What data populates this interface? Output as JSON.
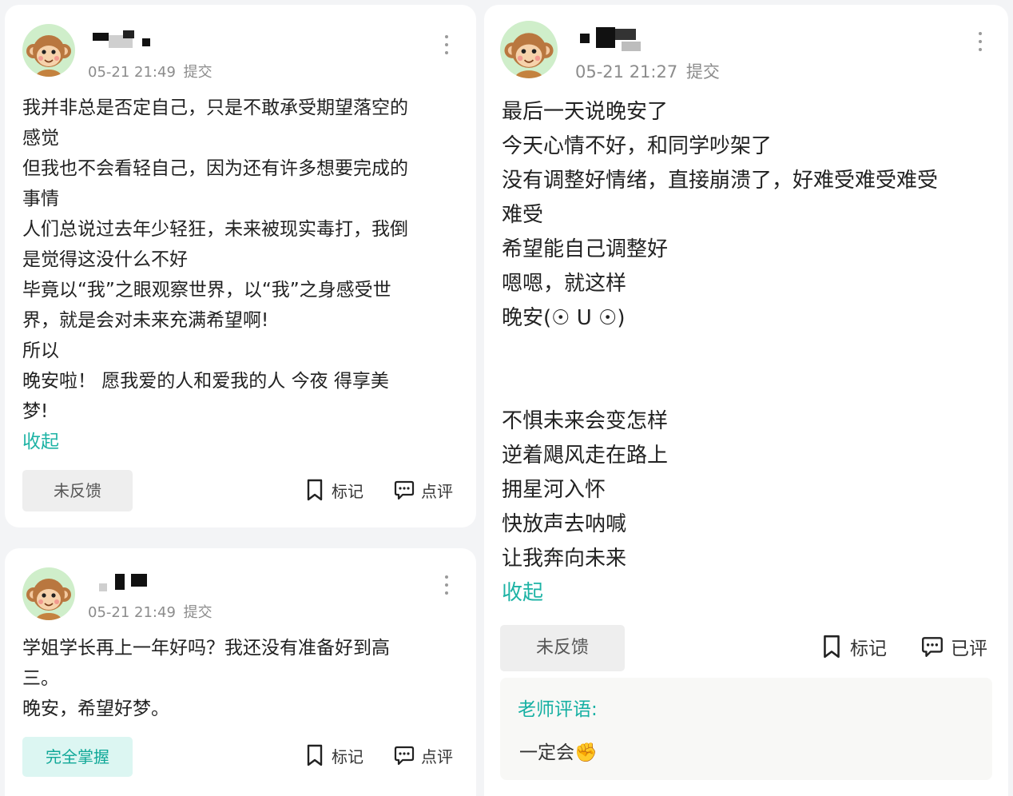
{
  "posts": [
    {
      "timestamp": "05-21 21:49",
      "status": "提交",
      "lines": [
        "我并非总是否定自己，只是不敢承受期望落空的",
        "感觉",
        "但我也不会看轻自己，因为还有许多想要完成的",
        "事情",
        "人们总说过去年少轻狂，未来被现实毒打，我倒",
        "是觉得这没什么不好",
        "毕竟以“我”之眼观察世界，以“我”之身感受世",
        "界，就是会对未来充满希望啊!",
        "所以",
        "晚安啦！ 愿我爱的人和爱我的人 今夜 得享美",
        "梦!"
      ],
      "collapse_label": "收起",
      "feedback_label": "未反馈",
      "mark_label": "标记",
      "comment_label": "点评"
    },
    {
      "timestamp": "05-21 21:49",
      "status": "提交",
      "lines": [
        "学姐学长再上一年好吗？我还没有准备好到高",
        "三。",
        "晚安，希望好梦。"
      ],
      "feedback_label": "完全掌握",
      "mark_label": "标记",
      "comment_label": "点评"
    },
    {
      "timestamp": "05-21 21:27",
      "status": "提交",
      "lines": [
        "最后一天说晚安了",
        "今天心情不好，和同学吵架了",
        "没有调整好情绪，直接崩溃了，好难受难受难受",
        "难受",
        "希望能自己调整好",
        "嗯嗯，就这样",
        "晚安(☉ U ☉)",
        "",
        "",
        "不惧未来会变怎样",
        "逆着飓风走在路上",
        "拥星河入怀",
        "快放声去呐喊",
        "让我奔向未来"
      ],
      "collapse_label": "收起",
      "feedback_label": "未反馈",
      "mark_label": "标记",
      "comment_label": "已评",
      "teacher_label": "老师评语:",
      "teacher_comment": "一定会",
      "teacher_emoji": "✊"
    }
  ],
  "colors": {
    "accent": "#1db3a5",
    "mastered_bg": "#dcf6f2",
    "page_bg": "#f3f4f6"
  }
}
